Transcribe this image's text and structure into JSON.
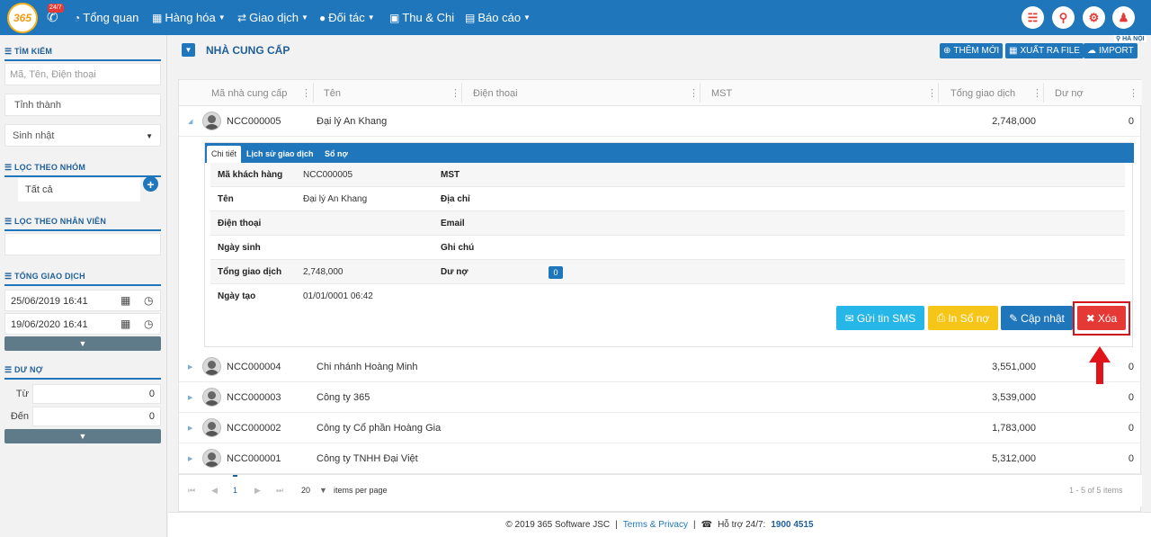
{
  "header": {
    "logo": "365",
    "badge": "24/7",
    "nav": [
      {
        "label": "Tổng quan",
        "icon": "dashboard-icon",
        "has_caret": false
      },
      {
        "label": "Hàng hóa",
        "icon": "cubes-icon",
        "has_caret": true
      },
      {
        "label": "Giao dịch",
        "icon": "exchange-icon",
        "has_caret": true
      },
      {
        "label": "Đối tác",
        "icon": "users-icon",
        "has_caret": true
      },
      {
        "label": "Thu & Chi",
        "icon": "money-icon",
        "has_caret": false
      },
      {
        "label": "Báo cáo",
        "icon": "bar-chart-icon",
        "has_caret": true
      }
    ],
    "right_icons": [
      "cart-icon",
      "map-marker-icon",
      "gear-icon",
      "user-icon"
    ]
  },
  "sidebar": {
    "search_title": "TÌM KIẾM",
    "search_placeholder": "Mã, Tên, Điện thoại",
    "province": "Tỉnh thành",
    "birthday": "Sinh nhật",
    "group_title": "LỌC THEO NHÓM",
    "group_all": "Tất cả",
    "staff_title": "LỌC THEO NHÂN VIÊN",
    "trans_title": "TỔNG GIAO DỊCH",
    "date_from": "25/06/2019 16:41",
    "date_to": "19/06/2020 16:41",
    "debt_title": "DƯ NỢ",
    "from_label": "Từ",
    "from_value": "0",
    "to_label": "Đến",
    "to_value": "0"
  },
  "main": {
    "title": "NHÀ CUNG CẤP",
    "region": "HÀ NỘI",
    "add_label": "THÊM MỚI",
    "export_label": "XUẤT RA FILE",
    "import_label": "IMPORT",
    "columns": [
      "Mã nhà cung cấp",
      "Tên",
      "Điện thoại",
      "MST",
      "Tổng giao dịch",
      "Dư nợ"
    ],
    "rows": [
      {
        "code": "NCC000005",
        "name": "Đại lý An Khang",
        "total": "2,748,000",
        "debt": "0"
      },
      {
        "code": "NCC000004",
        "name": "Chi nhánh Hoàng Minh",
        "total": "3,551,000",
        "debt": "0"
      },
      {
        "code": "NCC000003",
        "name": "Công ty 365",
        "total": "3,539,000",
        "debt": "0"
      },
      {
        "code": "NCC000002",
        "name": "Công ty Cổ phần Hoàng Gia",
        "total": "1,783,000",
        "debt": "0"
      },
      {
        "code": "NCC000001",
        "name": "Công ty TNHH Đại Việt",
        "total": "5,312,000",
        "debt": "0"
      }
    ],
    "detail": {
      "tabs": [
        "Chi tiết",
        "Lịch sử giao dịch",
        "Sổ nợ"
      ],
      "fields": {
        "code_label": "Mã khách hàng",
        "code_value": "NCC000005",
        "mst_label": "MST",
        "name_label": "Tên",
        "name_value": "Đại lý An Khang",
        "address_label": "Địa chỉ",
        "phone_label": "Điện thoại",
        "email_label": "Email",
        "birth_label": "Ngày sinh",
        "note_label": "Ghi chú",
        "total_label": "Tổng giao dịch",
        "total_value": "2,748,000",
        "debt_label": "Dư nợ",
        "debt_value": "0",
        "created_label": "Ngày tạo",
        "created_value": "01/01/0001 06:42"
      },
      "btn_sms": "Gửi tin SMS",
      "btn_print": "In Sổ nợ",
      "btn_update": "Cập nhật",
      "btn_delete": "Xóa"
    },
    "pager": {
      "page": "1",
      "page_size": "20",
      "items_per_page": "items per page",
      "summary": "1 - 5 of 5 items"
    }
  },
  "footer": {
    "copyright": "© 2019 365 Software JSC",
    "sep": "|",
    "terms": "Terms & Privacy",
    "support_label": "Hỗ trợ 24/7:",
    "support_phone": "1900 4515"
  },
  "colors": {
    "primary": "#1f76bb",
    "sms": "#26b6e8",
    "print": "#f5c518",
    "delete": "#e53935"
  }
}
